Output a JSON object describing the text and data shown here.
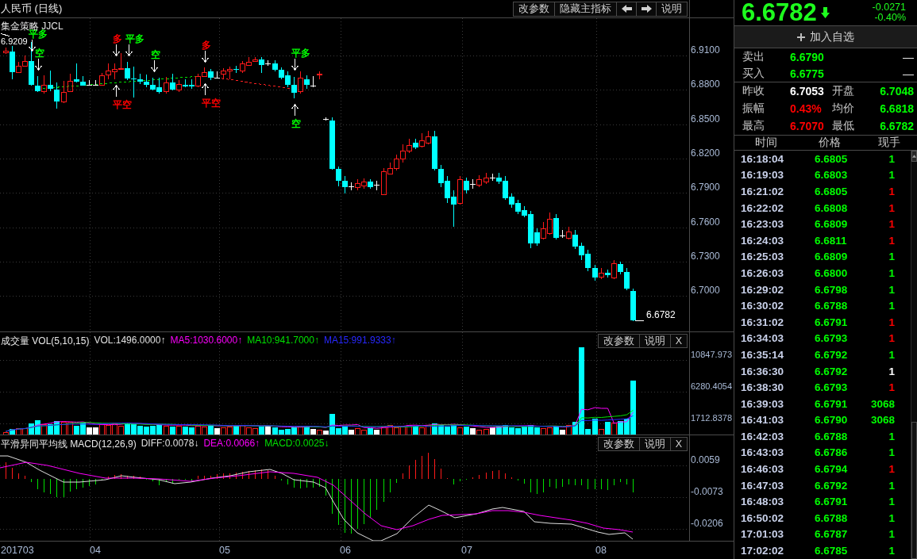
{
  "toolbar": {
    "title": "人民币 (日线)",
    "buttons": [
      {
        "kind": "text",
        "label": "改参数"
      },
      {
        "kind": "text",
        "label": "隐藏主指标"
      },
      {
        "kind": "prev"
      },
      {
        "kind": "next"
      },
      {
        "kind": "text",
        "label": "说明"
      }
    ]
  },
  "price_panel": {
    "indicator": "集金策略 JJCL",
    "signals": [
      {
        "label": "平多",
        "kind": "above",
        "color": "#00ff00"
      },
      {
        "label": "空",
        "kind": "above",
        "color": "#00ff00"
      },
      {
        "label": "多",
        "kind": "above",
        "color": "#ff0000"
      },
      {
        "label": "平空",
        "kind": "below",
        "color": "#ff0000"
      },
      {
        "label": "平多",
        "kind": "above",
        "color": "#00ff00"
      },
      {
        "label": "空",
        "kind": "above",
        "color": "#00ff00"
      },
      {
        "label": "多",
        "kind": "above",
        "color": "#ff0000"
      },
      {
        "label": "平空",
        "kind": "below",
        "color": "#ff0000"
      },
      {
        "label": "平多",
        "kind": "above",
        "color": "#00ff00"
      },
      {
        "label": "空",
        "kind": "below",
        "color": "#00ff00"
      }
    ],
    "high_label": "6.9209",
    "last_label": "6.6782",
    "axis_labels": [
      "6.9100",
      "6.8800",
      "6.8500",
      "6.8200",
      "6.7900",
      "6.7600",
      "6.7300",
      "6.7000"
    ]
  },
  "volume_panel": {
    "title": "成交量 VOL(5,10,15)",
    "values": [
      {
        "label": "VOL:1496.0000↑",
        "color": "#e0e0e0"
      },
      {
        "label": "MA5:1030.6000↑",
        "color": "#ff00ff"
      },
      {
        "label": "MA10:941.7000↑",
        "color": "#00e000"
      },
      {
        "label": "MA15:991.9333↑",
        "color": "#2828ff"
      }
    ],
    "buttons": [
      "改参数",
      "说明",
      "X"
    ],
    "axis_labels": [
      "10847.973",
      "6280.4054",
      "1712.8378"
    ]
  },
  "macd_panel": {
    "title": "平滑异同平均线 MACD(12,26,9)",
    "values": [
      {
        "label": "DIFF:0.0078↓",
        "color": "#e0e0e0"
      },
      {
        "label": "DEA:0.0066↑",
        "color": "#ff00ff"
      },
      {
        "label": "MACD:0.0025↓",
        "color": "#00e000"
      }
    ],
    "buttons": [
      "改参数",
      "说明",
      "X"
    ],
    "axis_labels": [
      "0.0059",
      "-0.0073",
      "-0.0206"
    ]
  },
  "date_axis": [
    "201703",
    "04",
    "05",
    "06",
    "07",
    "08"
  ],
  "quote": {
    "price": "6.6782",
    "falling": true,
    "change": "-0.0271",
    "change_percent": "-0.40%"
  },
  "watchlist_button": "加入自选",
  "order_book": [
    {
      "label": "卖出",
      "price": "6.6790",
      "volume": "—"
    },
    {
      "label": "买入",
      "price": "6.6775",
      "volume": "—"
    }
  ],
  "stats": [
    {
      "label": "昨收",
      "value": "6.7053",
      "color": "#ffffff"
    },
    {
      "label": "开盘",
      "value": "6.7048",
      "color": "#00ff00"
    },
    {
      "label": "振幅",
      "value": "0.43%",
      "color": "#ff0000"
    },
    {
      "label": "均价",
      "value": "6.6818",
      "color": "#00ff00"
    },
    {
      "label": "最高",
      "value": "6.7070",
      "color": "#ff0000"
    },
    {
      "label": "最低",
      "value": "6.6782",
      "color": "#00ff00"
    }
  ],
  "trades": {
    "columns": [
      "时间",
      "价格",
      "现手"
    ],
    "rows": [
      {
        "time": "16:18:04",
        "price": "6.6805",
        "volume": "1",
        "color": "#00ff00"
      },
      {
        "time": "16:19:03",
        "price": "6.6803",
        "volume": "1",
        "color": "#00ff00"
      },
      {
        "time": "16:21:02",
        "price": "6.6805",
        "volume": "1",
        "color": "#ff0000"
      },
      {
        "time": "16:22:02",
        "price": "6.6808",
        "volume": "1",
        "color": "#ff0000"
      },
      {
        "time": "16:23:03",
        "price": "6.6809",
        "volume": "1",
        "color": "#ff0000"
      },
      {
        "time": "16:24:03",
        "price": "6.6811",
        "volume": "1",
        "color": "#ff0000"
      },
      {
        "time": "16:25:03",
        "price": "6.6809",
        "volume": "1",
        "color": "#00ff00"
      },
      {
        "time": "16:26:03",
        "price": "6.6800",
        "volume": "1",
        "color": "#00ff00"
      },
      {
        "time": "16:29:02",
        "price": "6.6798",
        "volume": "1",
        "color": "#00ff00"
      },
      {
        "time": "16:30:02",
        "price": "6.6788",
        "volume": "1",
        "color": "#00ff00"
      },
      {
        "time": "16:31:02",
        "price": "6.6791",
        "volume": "1",
        "color": "#ff0000"
      },
      {
        "time": "16:34:03",
        "price": "6.6793",
        "volume": "1",
        "color": "#ff0000"
      },
      {
        "time": "16:35:14",
        "price": "6.6792",
        "volume": "1",
        "color": "#00ff00"
      },
      {
        "time": "16:36:30",
        "price": "6.6792",
        "volume": "1",
        "color": "#ffffff"
      },
      {
        "time": "16:38:30",
        "price": "6.6793",
        "volume": "1",
        "color": "#ff0000"
      },
      {
        "time": "16:39:03",
        "price": "6.6791",
        "volume": "3068",
        "color": "#00ff00"
      },
      {
        "time": "16:41:03",
        "price": "6.6790",
        "volume": "3068",
        "color": "#00ff00"
      },
      {
        "time": "16:42:03",
        "price": "6.6788",
        "volume": "1",
        "color": "#00ff00"
      },
      {
        "time": "16:43:03",
        "price": "6.6786",
        "volume": "1",
        "color": "#00ff00"
      },
      {
        "time": "16:46:03",
        "price": "6.6794",
        "volume": "1",
        "color": "#ff0000"
      },
      {
        "time": "16:47:03",
        "price": "6.6792",
        "volume": "1",
        "color": "#00ff00"
      },
      {
        "time": "16:48:03",
        "price": "6.6791",
        "volume": "1",
        "color": "#00ff00"
      },
      {
        "time": "16:50:02",
        "price": "6.6788",
        "volume": "1",
        "color": "#00ff00"
      },
      {
        "time": "17:01:03",
        "price": "6.6787",
        "volume": "1",
        "color": "#00ff00"
      },
      {
        "time": "17:02:02",
        "price": "6.6785",
        "volume": "1",
        "color": "#00ff00"
      }
    ]
  }
}
